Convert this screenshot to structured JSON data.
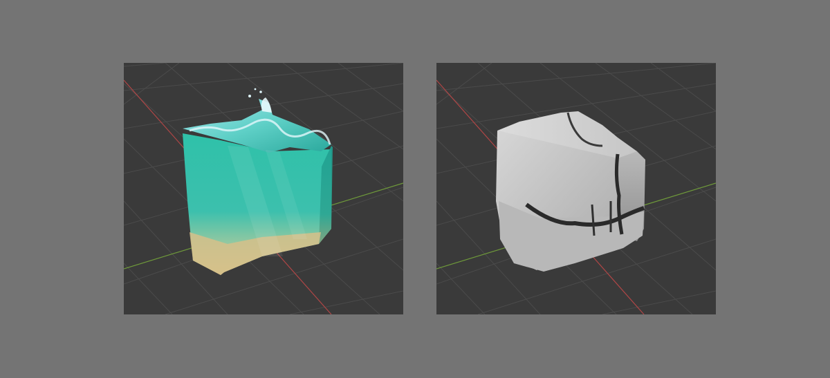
{
  "scene": {
    "background_color": "#747474",
    "viewport_color": "#3a3a3a",
    "grid_color": "#4a4a4a",
    "x_axis_color": "#b04646",
    "y_axis_color": "#6f9a3a",
    "panels": [
      {
        "subject": "water-cube",
        "palette": [
          "#2bb39e",
          "#7fd6e3",
          "#d9c48a"
        ]
      },
      {
        "subject": "cracked-stone-cube",
        "palette": [
          "#e0e0e0",
          "#a8a8a8",
          "#2a2a2a"
        ]
      }
    ]
  }
}
